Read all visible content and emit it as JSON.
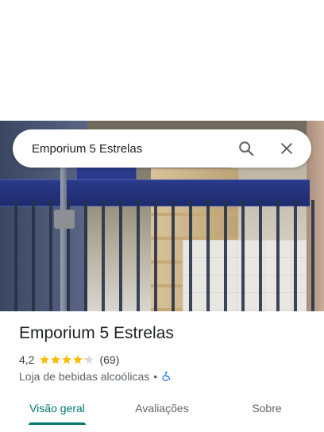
{
  "search": {
    "value": "Emporium 5 Estrelas",
    "search_icon": "search-icon",
    "close_icon": "close-icon"
  },
  "place": {
    "title": "Emporium 5 Estrelas",
    "rating": "4,2",
    "rating_value": 4.2,
    "rating_max": 5,
    "review_count": "(69)",
    "category": "Loja de bebidas alcoólicas",
    "separator": "•",
    "accessibility_icon": "wheelchair-icon"
  },
  "tabs": [
    {
      "label": "Visão geral",
      "active": true
    },
    {
      "label": "Avaliações",
      "active": false
    },
    {
      "label": "Sobre",
      "active": false
    }
  ],
  "colors": {
    "accent": "#00796b",
    "star": "#fbbc04",
    "star_empty": "#dadce0",
    "accessibility_blue": "#1a73e8"
  }
}
